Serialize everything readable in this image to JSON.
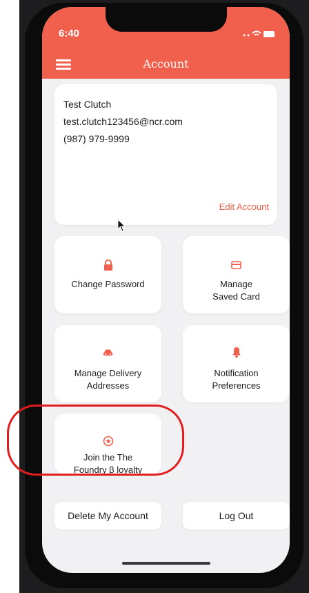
{
  "status_bar": {
    "time": "6:40"
  },
  "header": {
    "title": "Account"
  },
  "profile": {
    "name": "Test Clutch",
    "email": "test.clutch123456@ncr.com",
    "phone": "(987) 979-9999",
    "edit_label": "Edit Account"
  },
  "tiles": {
    "change_password": {
      "label": "Change Password",
      "icon": "lock-icon"
    },
    "manage_card": {
      "line1": "Manage",
      "line2": "Saved Card",
      "icon": "credit-card-icon"
    },
    "delivery": {
      "line1": "Manage Delivery",
      "line2": "Addresses",
      "icon": "car-icon"
    },
    "notifications": {
      "line1": "Notification",
      "line2": "Preferences",
      "icon": "bell-icon"
    },
    "loyalty": {
      "line1": "Join the The",
      "line2": "Foundry β loyalty",
      "icon": "star-circle-icon"
    }
  },
  "actions": {
    "delete": "Delete My Account",
    "logout": "Log Out"
  },
  "colors": {
    "accent": "#f0604c",
    "background": "#f1f1f3",
    "annotation": "#e11d1d"
  }
}
